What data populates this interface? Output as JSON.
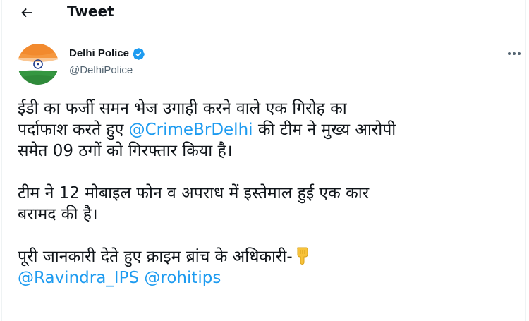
{
  "header": {
    "back_icon": "arrow-left-icon",
    "title": "Tweet"
  },
  "author": {
    "name": "Delhi Police",
    "handle": "@DelhiPolice",
    "verified_icon": "verified-badge-icon",
    "avatar_icon": "india-flag-avatar"
  },
  "more_icon": "more-options-icon",
  "tweet": {
    "p1_a": "ईडी का फर्जी समन भेज उगाही करने वाले एक गिरोह का",
    "p1_b": "पर्दाफाश करते हुए ",
    "mention_crime": "@CrimeBrDelhi",
    "p1_c": " की टीम ने मुख्य आरोपी",
    "p1_d": "समेत 09 ठगों को गिरफ्तार किया है।",
    "p2_a": "टीम ने 12 मोबाइल फोन व अपराध में इस्तेमाल हुई एक कार",
    "p2_b": "बरामद की है।",
    "p3_a": "पूरी जानकारी देते हुए क्राइम ब्रांच के अधिकारी-",
    "emoji": "pointing-down-hand-emoji",
    "mention_ravindra": "@Ravindra_IPS",
    "mention_rohit": "@rohitips"
  },
  "colors": {
    "link": "#1d9bf0",
    "verified": "#1d9bf0",
    "text": "#0f1419",
    "secondary": "#536471"
  }
}
